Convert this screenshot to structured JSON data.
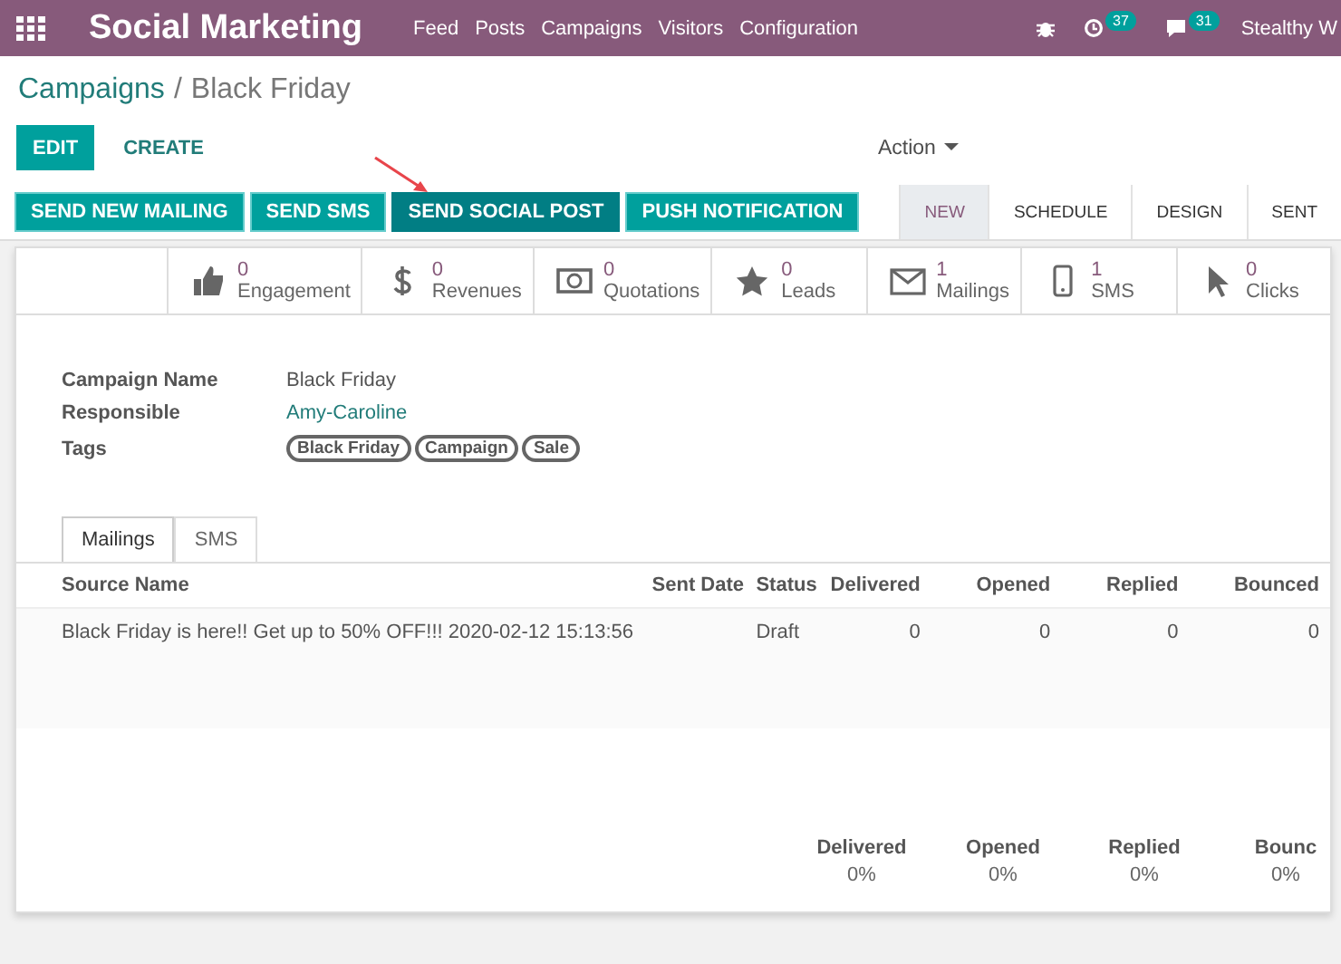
{
  "navbar": {
    "app_title": "Social Marketing",
    "menu": [
      "Feed",
      "Posts",
      "Campaigns",
      "Visitors",
      "Configuration"
    ],
    "activity_count": "37",
    "message_count": "31",
    "user": "Stealthy W"
  },
  "breadcrumb": {
    "parent": "Campaigns",
    "separator": "/",
    "current": "Black Friday"
  },
  "control_buttons": {
    "edit": "EDIT",
    "create": "CREATE",
    "action": "Action"
  },
  "header_buttons": [
    {
      "label": "SEND NEW MAILING",
      "selected": false
    },
    {
      "label": "SEND SMS",
      "selected": false
    },
    {
      "label": "SEND SOCIAL POST",
      "selected": true
    },
    {
      "label": "PUSH NOTIFICATION",
      "selected": false
    }
  ],
  "stages": [
    {
      "label": "NEW",
      "selected": true
    },
    {
      "label": "SCHEDULE",
      "selected": false
    },
    {
      "label": "DESIGN",
      "selected": false
    },
    {
      "label": "SENT",
      "selected": false
    }
  ],
  "stat_buttons": [
    {
      "kind": "thumb",
      "value": "0",
      "label": "Engagement"
    },
    {
      "kind": "dollar",
      "value": "0",
      "label": "Revenues"
    },
    {
      "kind": "money",
      "value": "0",
      "label": "Quotations"
    },
    {
      "kind": "star",
      "value": "0",
      "label": "Leads"
    },
    {
      "kind": "envelope",
      "value": "1",
      "label": "Mailings"
    },
    {
      "kind": "phone",
      "value": "1",
      "label": "SMS"
    },
    {
      "kind": "pointer",
      "value": "0",
      "label": "Clicks"
    }
  ],
  "fields": [
    {
      "kind": "text",
      "label": "Campaign Name",
      "value": "Black Friday"
    },
    {
      "kind": "link",
      "label": "Responsible",
      "value": "Amy-Caroline"
    },
    {
      "kind": "tags",
      "label": "Tags",
      "tags": [
        "Black Friday",
        "Campaign",
        "Sale"
      ]
    }
  ],
  "tabs": [
    {
      "label": "Mailings",
      "selected": true
    },
    {
      "label": "SMS",
      "selected": false
    }
  ],
  "table": {
    "columns": [
      "Source Name",
      "Sent Date",
      "Status",
      "Delivered",
      "Opened",
      "Replied",
      "Bounced"
    ],
    "rows": [
      [
        "Black Friday is here!! Get up to 50% OFF!!! 2020-02-12 15:13:56",
        "",
        "Draft",
        "0",
        "0",
        "0",
        "0"
      ]
    ]
  },
  "totals": [
    {
      "label": "Delivered",
      "value": "0%"
    },
    {
      "label": "Opened",
      "value": "0%"
    },
    {
      "label": "Replied",
      "value": "0%"
    },
    {
      "label": "Bounc",
      "value": "0%"
    }
  ]
}
